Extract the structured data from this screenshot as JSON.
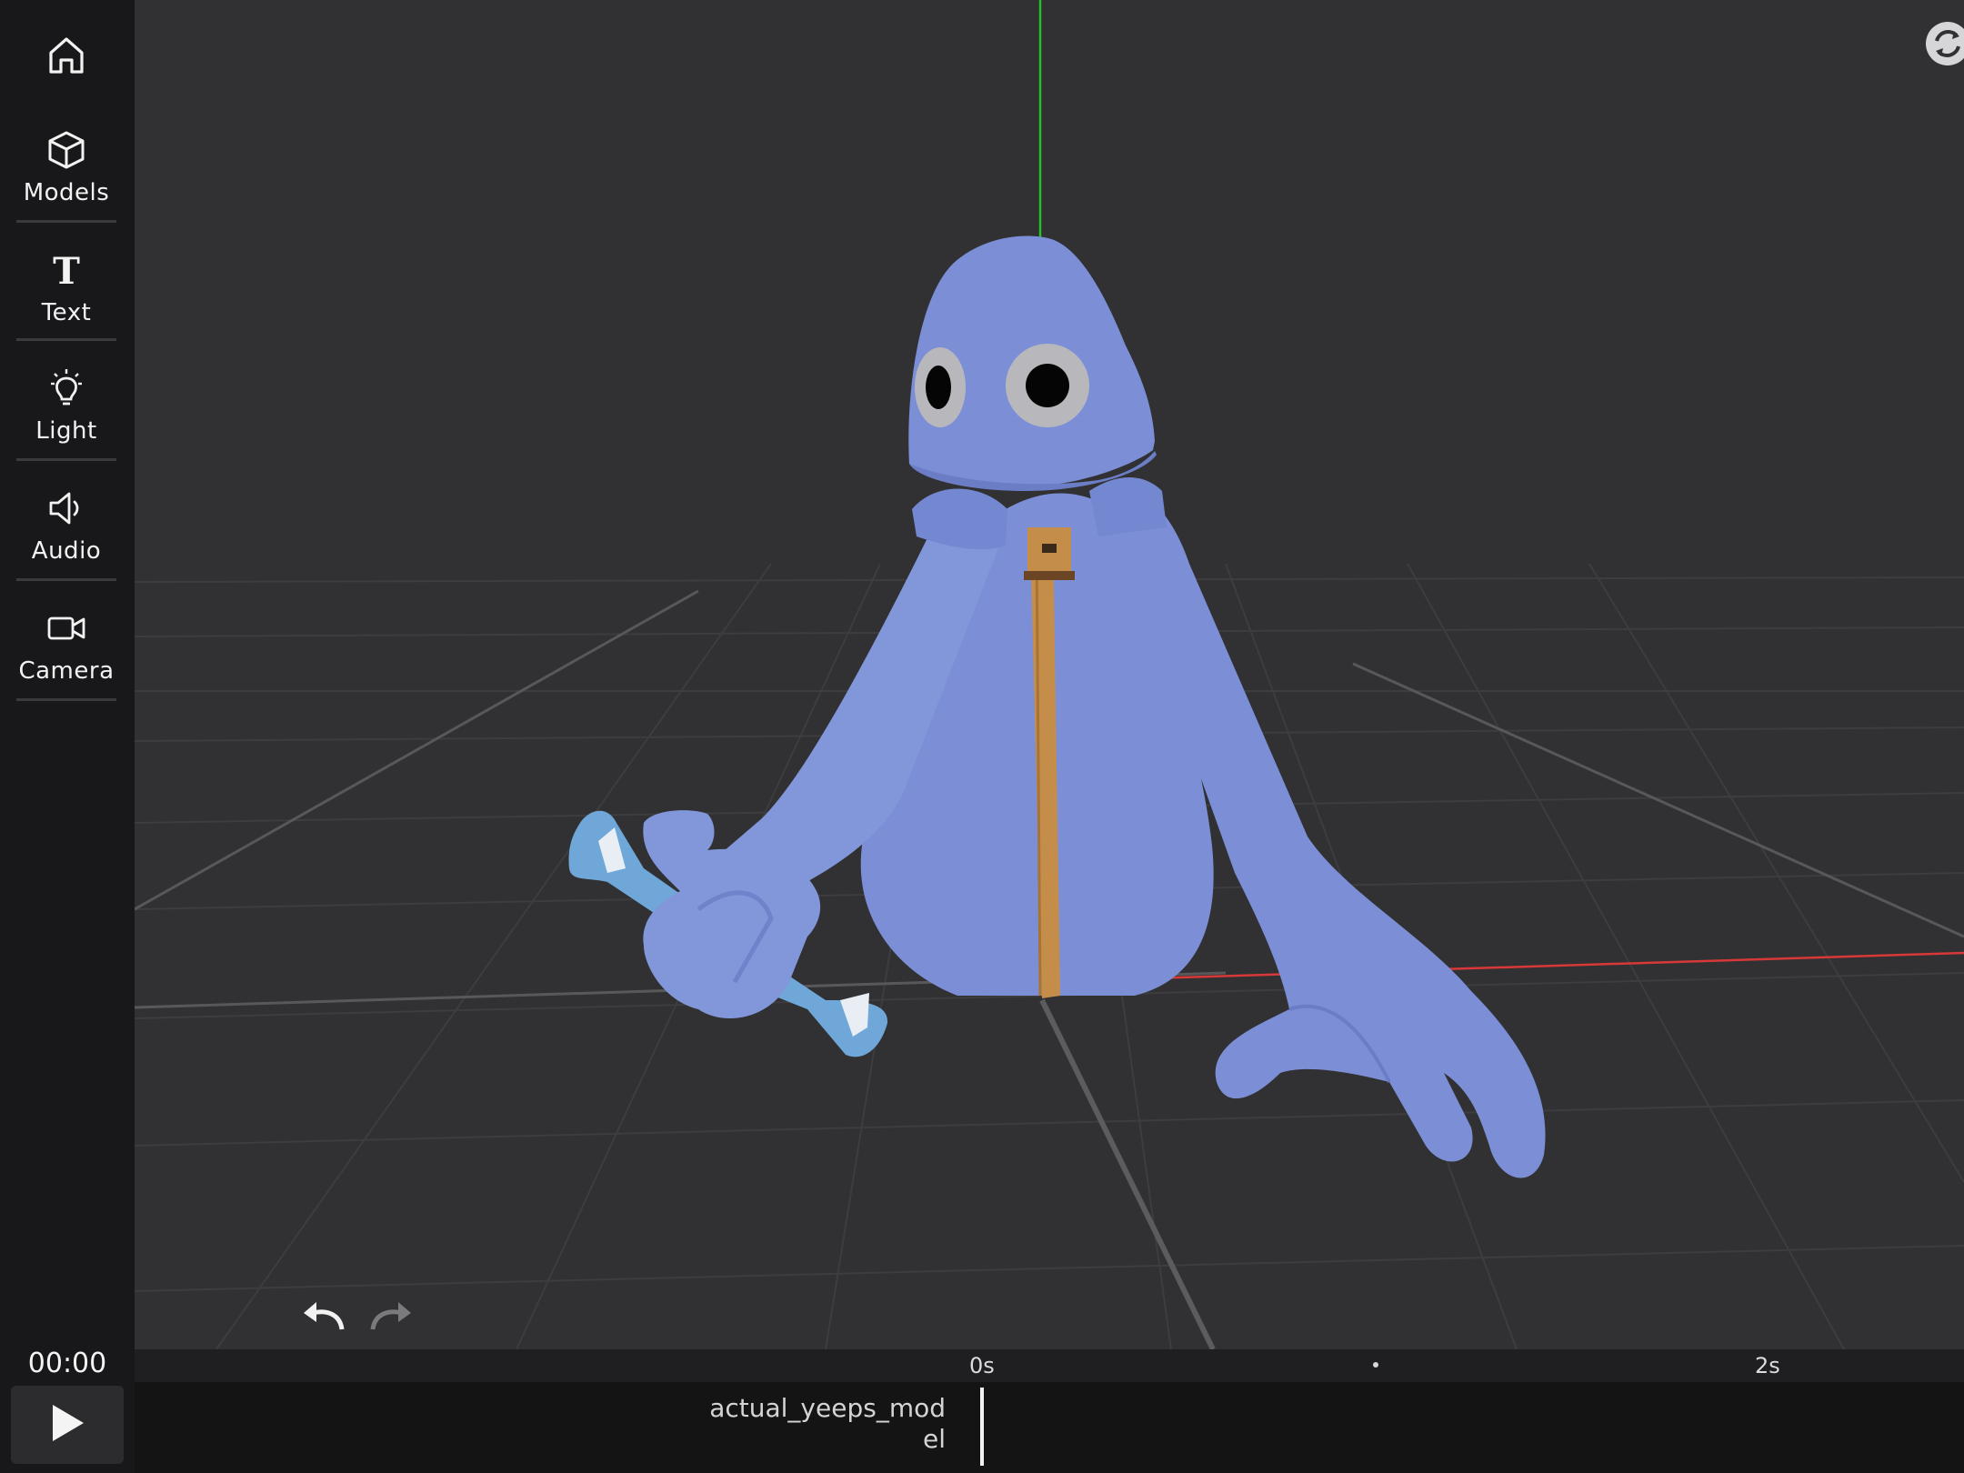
{
  "sidebar": {
    "home_icon": "home-icon",
    "items": [
      {
        "label": "Models",
        "icon": "cube-icon"
      },
      {
        "label": "Text",
        "icon": "text-icon"
      },
      {
        "label": "Light",
        "icon": "lightbulb-icon"
      },
      {
        "label": "Audio",
        "icon": "speaker-icon"
      },
      {
        "label": "Camera",
        "icon": "video-camera-icon"
      }
    ]
  },
  "playback": {
    "timecode": "00:00",
    "play_icon": "play-icon"
  },
  "viewport": {
    "background_color": "#313133",
    "character_color": "#7c8fd6",
    "zipper_color": "#c58d4a",
    "axis_y_color": "#28c028",
    "axis_x_color": "#d83838"
  },
  "toolbar": {
    "refresh_icon": "refresh-icon",
    "share_icon": "share-arrow-icon",
    "list_icon": "list-icon",
    "undo_icon": "undo-icon",
    "redo_icon": "redo-icon"
  },
  "timeline": {
    "tick_start": "0s",
    "tick_end": "2s",
    "track_name": "actual_yeeps_model"
  }
}
